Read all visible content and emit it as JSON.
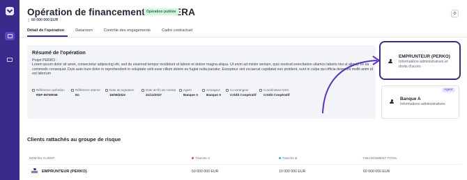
{
  "header": {
    "title": "Opération de financement BARBERA",
    "status_badge": "Opération publiée",
    "amount": "60 000 000 EUR",
    "settings_icon": "gear-icon"
  },
  "tabs": [
    {
      "label": "Détail de l'opération",
      "active": true
    },
    {
      "label": "Dataroom",
      "active": false
    },
    {
      "label": "Contrôle des engagements",
      "active": false
    },
    {
      "label": "Cadre contractuel",
      "active": false
    }
  ],
  "summary": {
    "title": "Résumé de l'opération",
    "project": "Projet PERKO :",
    "description": "Lorem ipsum dolor sit amet, consectetur adipiscing elit, sed do eiusmod tempor incididunt ut labore et dolore magna aliqua. Ut enim ad minim veniam, quis nostrud exercitation ullamco laboris nisi ut aliquip ex ea commodo consequat. Duis aute irure dolor in reprehenderit in voluptate velit esse cillum dolore eu fugiat nulla pariatur. Excepteur sint occaecat cupidatat non proident, sunt in culpa qui officia deserunt mollit anim id est laborum",
    "meta": [
      {
        "label": "Référence opération",
        "value": "REF-INTERNE"
      },
      {
        "label": "Référence interne",
        "value": "Nc"
      },
      {
        "label": "Date de signature",
        "value": "16/09/2022"
      },
      {
        "label": "Date de fin de contrat",
        "value": "31/12/2027"
      },
      {
        "label": "Agent",
        "value": "Banque A"
      },
      {
        "label": "Arrangeur",
        "value": "Banque A"
      },
      {
        "label": "Co-arrangeur",
        "value": "Crédit Coopératif"
      },
      {
        "label": "Coordinateur ESG",
        "value": "Crédit Coopératif"
      }
    ]
  },
  "parties": {
    "borrower": {
      "name": "EMPRUNTEUR (PERKO)",
      "subtitle": "Informations administratives et droits d'accès"
    },
    "agent": {
      "name": "Banque A",
      "subtitle": "Informations administratives",
      "badge": "Agent"
    }
  },
  "clients": {
    "title": "Clients rattachés au groupe de risque",
    "columns": [
      "NOM DU CLIENT",
      "Tranche A",
      "Tranche B",
      "FINANCEMENT TOTAL"
    ],
    "tranche_colors": {
      "a": "#e0395a",
      "b": "#3aa6e0"
    },
    "rows": [
      {
        "name": "EMPRUNTEUR (PERKO)",
        "tranche_a": "50 000 000 EUR",
        "tranche_b": "10 000 000 EUR",
        "total": "60 000 000 EUR"
      }
    ]
  },
  "colors": {
    "accent": "#3b2a8c",
    "sidebar": "#3b2a8c"
  }
}
